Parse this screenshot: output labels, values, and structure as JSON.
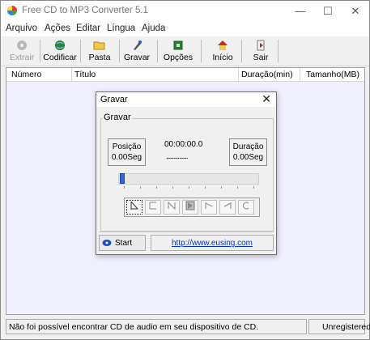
{
  "window": {
    "title": "Free CD to MP3 Converter 5.1"
  },
  "window_controls": {
    "minimize": "—",
    "maximize": "☐",
    "close": "✕"
  },
  "menu": [
    "Arquivo",
    "Ações",
    "Editar",
    "Língua",
    "Ajuda"
  ],
  "toolbar": {
    "buttons": [
      {
        "label": "Extrair",
        "icon": "disc-extract-icon",
        "enabled": false
      },
      {
        "label": "Codificar",
        "icon": "globe-encode-icon",
        "enabled": true
      },
      {
        "label": "Pasta",
        "icon": "folder-icon",
        "enabled": true
      },
      {
        "label": "Gravar",
        "icon": "pen-record-icon",
        "enabled": true
      },
      {
        "label": "Opções",
        "icon": "options-icon",
        "enabled": true
      },
      {
        "label": "Início",
        "icon": "home-icon",
        "enabled": true
      },
      {
        "label": "Sair",
        "icon": "exit-icon",
        "enabled": true
      }
    ]
  },
  "list": {
    "columns": [
      "Número",
      "Título",
      "Duração(min)",
      "Tamanho(MB)"
    ]
  },
  "dialog": {
    "title": "Gravar",
    "close": "✕",
    "group_label": "Gravar",
    "position_label": "Posição",
    "position_value": "0.00Seg",
    "time": "00:00:00.0",
    "time_dots": "...............",
    "duration_label": "Duração",
    "duration_value": "0.00Seg",
    "progress": 0,
    "start_label": "Start",
    "link": "http://www.eusing.com"
  },
  "status": {
    "message": "Não foi possível encontrar CD de audio em seu dispositivo de CD.",
    "registration": "Unregistered"
  }
}
